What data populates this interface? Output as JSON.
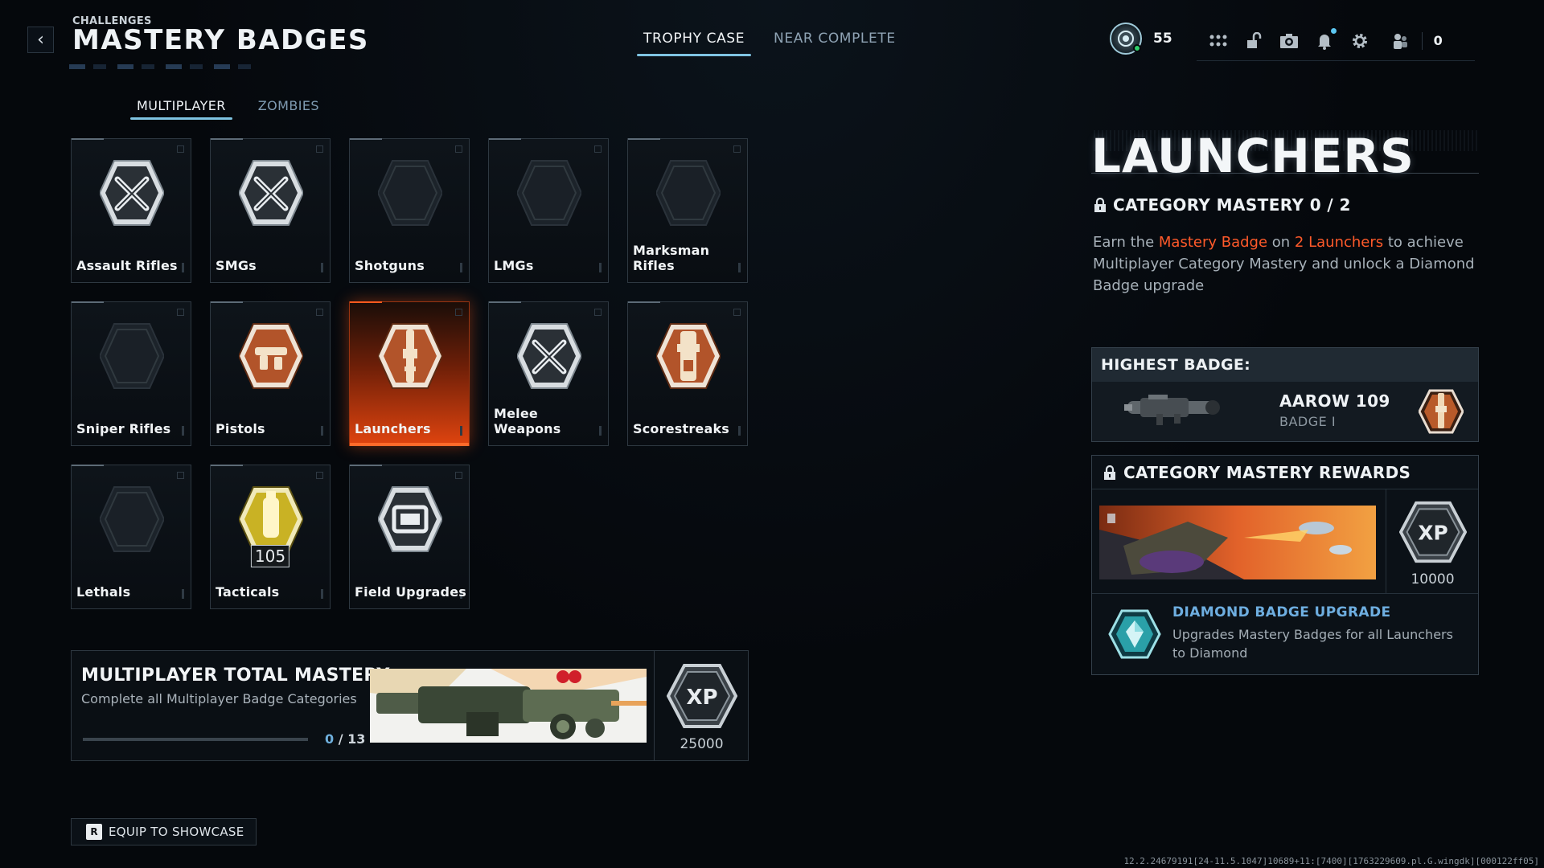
{
  "header": {
    "eyebrow": "CHALLENGES",
    "title": "MASTERY BADGES",
    "tabs": [
      {
        "label": "TROPHY CASE",
        "active": true
      },
      {
        "label": "NEAR COMPLETE",
        "active": false
      }
    ]
  },
  "status": {
    "level": "55",
    "icons": [
      "grid-menu-icon",
      "unlock-icon",
      "camera-icon",
      "bell-icon",
      "gear-icon"
    ],
    "party_count": "0"
  },
  "mode_tabs": [
    {
      "label": "MULTIPLAYER",
      "active": true
    },
    {
      "label": "ZOMBIES",
      "active": false
    }
  ],
  "badges": [
    {
      "label": "Assault Rifles",
      "state": "silver",
      "icon": "crossed-rifles-badge-icon"
    },
    {
      "label": "SMGs",
      "state": "silver",
      "icon": "crossed-smgs-badge-icon"
    },
    {
      "label": "Shotguns",
      "state": "locked",
      "icon": "empty-hex-icon"
    },
    {
      "label": "LMGs",
      "state": "locked",
      "icon": "empty-hex-icon"
    },
    {
      "label": "Marksman Rifles",
      "state": "locked",
      "icon": "empty-hex-icon"
    },
    {
      "label": "Sniper Rifles",
      "state": "locked",
      "icon": "empty-hex-icon"
    },
    {
      "label": "Pistols",
      "state": "bronze",
      "icon": "pistol-badge-icon"
    },
    {
      "label": "Launchers",
      "state": "bronze",
      "icon": "launcher-badge-icon",
      "selected": true
    },
    {
      "label": "Melee Weapons",
      "state": "silver",
      "icon": "crossed-blades-badge-icon"
    },
    {
      "label": "Scorestreaks",
      "state": "bronze",
      "icon": "scorestreak-badge-icon"
    },
    {
      "label": "Lethals",
      "state": "locked",
      "icon": "empty-hex-icon"
    },
    {
      "label": "Tacticals",
      "state": "gold",
      "icon": "tactical-badge-icon",
      "count": "105"
    },
    {
      "label": "Field Upgrades",
      "state": "silver",
      "icon": "field-upgrade-badge-icon"
    }
  ],
  "total_mastery": {
    "title": "MULTIPLAYER TOTAL MASTERY",
    "desc": "Complete all Multiplayer Badge Categories",
    "progress_current": "0",
    "progress_sep": " / ",
    "progress_total": "13",
    "progress_fraction": 0,
    "reward_amount": "25000",
    "reward_icon": "xp-icon"
  },
  "equip": {
    "key": "R",
    "label": "EQUIP TO SHOWCASE"
  },
  "detail": {
    "title": "LAUNCHERS",
    "category_mastery": "CATEGORY MASTERY 0 / 2",
    "desc_pre": "Earn the ",
    "desc_hl1": "Mastery Badge",
    "desc_mid": " on ",
    "desc_hl2": "2 Launchers",
    "desc_post": " to achieve Multiplayer Category Mastery and unlock a Diamond Badge upgrade",
    "highest_badge_heading": "HIGHEST BADGE:",
    "highest_badge_weapon": "AAROW 109",
    "highest_badge_tier": "BADGE I",
    "rewards_heading": "CATEGORY MASTERY REWARDS",
    "reward_xp": "10000",
    "upgrade_title": "DIAMOND BADGE UPGRADE",
    "upgrade_desc": "Upgrades Mastery Badges for all Launchers to Diamond"
  },
  "build_string": "12.2.24679191[24-11.5.1047]10689+11:[7400][1763229609.pl.G.wingdk][000122ff05]",
  "colors": {
    "accent_blue": "#7fc4e2",
    "highlight_orange": "#ff5a2a",
    "selected_tile": "#e0440f",
    "diamond_blue": "#6eaee0"
  }
}
